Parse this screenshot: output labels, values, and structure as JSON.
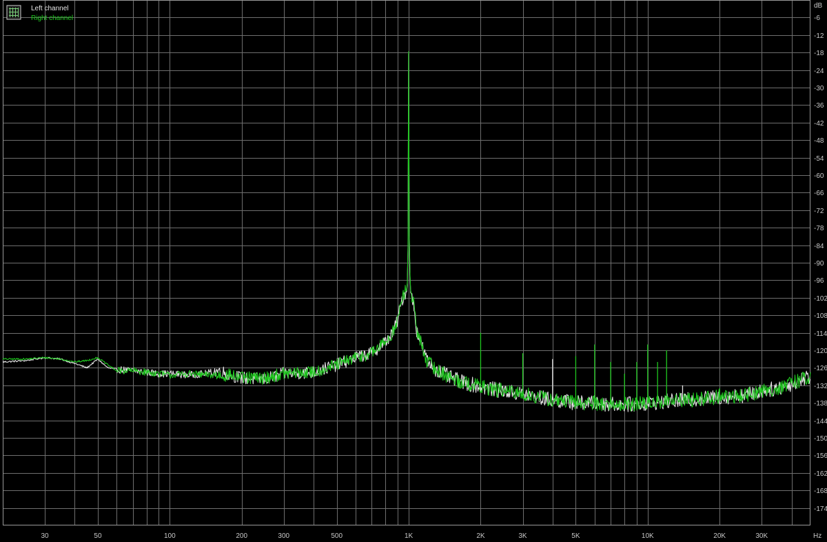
{
  "chart_data": {
    "type": "line",
    "title": "",
    "xlabel": "",
    "ylabel": "",
    "x_scale": "log",
    "x_unit": "Hz",
    "y_unit": "dB",
    "xlim": [
      20,
      48000
    ],
    "ylim": [
      -180,
      0
    ],
    "grid": true,
    "legend": "top-left",
    "x_tick_labels": [
      {
        "value": 30,
        "label": "30"
      },
      {
        "value": 50,
        "label": "50"
      },
      {
        "value": 100,
        "label": "100"
      },
      {
        "value": 200,
        "label": "200"
      },
      {
        "value": 300,
        "label": "300"
      },
      {
        "value": 500,
        "label": "500"
      },
      {
        "value": 1000,
        "label": "1K"
      },
      {
        "value": 2000,
        "label": "2K"
      },
      {
        "value": 3000,
        "label": "3K"
      },
      {
        "value": 5000,
        "label": "5K"
      },
      {
        "value": 10000,
        "label": "10K"
      },
      {
        "value": 20000,
        "label": "20K"
      },
      {
        "value": 30000,
        "label": "30K"
      }
    ],
    "y_ticks": [
      -6,
      -12,
      -18,
      -24,
      -30,
      -36,
      -42,
      -48,
      -54,
      -60,
      -66,
      -72,
      -78,
      -84,
      -90,
      -96,
      -102,
      -108,
      -114,
      -120,
      -126,
      -132,
      -138,
      -144,
      -150,
      -156,
      -162,
      -168,
      -174
    ],
    "colors": {
      "background": "#000000",
      "grid": "#6f6f6f",
      "left": "#e6e6e6",
      "right": "#1fc81f",
      "tick": "#c8c8c8"
    },
    "series": [
      {
        "name": "Left channel",
        "x": [
          20,
          25,
          30,
          35,
          40,
          45,
          50,
          55,
          60,
          70,
          80,
          90,
          100,
          120,
          140,
          160,
          180,
          200,
          250,
          300,
          400,
          500,
          600,
          700,
          800,
          850,
          900,
          930,
          950,
          970,
          985,
          995,
          1000,
          1005,
          1015,
          1030,
          1050,
          1080,
          1100,
          1150,
          1200,
          1300,
          1400,
          1500,
          1700,
          2000,
          2500,
          3000,
          4000,
          5000,
          6000,
          7000,
          8000,
          9000,
          10000,
          12000,
          15000,
          20000,
          25000,
          30000,
          35000,
          40000,
          45000,
          48000
        ],
        "y": [
          -124,
          -123.5,
          -122.5,
          -123,
          -124.5,
          -126,
          -123,
          -126,
          -126.5,
          -127,
          -127.5,
          -128,
          -128,
          -128.5,
          -128,
          -127,
          -128.5,
          -129.5,
          -130,
          -128,
          -127.5,
          -125,
          -122.5,
          -121,
          -117,
          -114.5,
          -109.5,
          -104,
          -101,
          -100,
          -100,
          -80,
          -4,
          -80,
          -100,
          -101,
          -105,
          -113,
          -115,
          -120,
          -124,
          -126.5,
          -128,
          -129.5,
          -131,
          -132.5,
          -134,
          -135,
          -137,
          -138,
          -138,
          -138.5,
          -138.5,
          -138.5,
          -138,
          -137.5,
          -137,
          -136,
          -135.5,
          -134,
          -133,
          -131.5,
          -129.5,
          -129
        ]
      },
      {
        "name": "Right channel",
        "x": [
          20,
          25,
          30,
          35,
          40,
          45,
          50,
          55,
          60,
          70,
          80,
          90,
          100,
          120,
          140,
          160,
          180,
          200,
          250,
          300,
          400,
          500,
          600,
          700,
          800,
          850,
          900,
          930,
          950,
          970,
          985,
          995,
          1000,
          1005,
          1015,
          1030,
          1050,
          1080,
          1100,
          1150,
          1200,
          1300,
          1400,
          1500,
          1700,
          2000,
          2500,
          3000,
          4000,
          5000,
          6000,
          7000,
          8000,
          9000,
          10000,
          12000,
          15000,
          20000,
          25000,
          30000,
          35000,
          40000,
          45000,
          48000
        ],
        "y": [
          -123,
          -123,
          -122.5,
          -123,
          -124,
          -123.5,
          -122.5,
          -125,
          -127,
          -127,
          -127.5,
          -128,
          -128.5,
          -128,
          -128.5,
          -128.5,
          -128.5,
          -129.5,
          -129.5,
          -128,
          -127.5,
          -125,
          -122.5,
          -121,
          -117,
          -114.5,
          -109.5,
          -104,
          -101,
          -100,
          -99,
          -80,
          -3,
          -80,
          -99,
          -101,
          -105,
          -113,
          -115,
          -120,
          -124,
          -126.5,
          -128,
          -129.5,
          -131,
          -132.5,
          -134,
          -135,
          -137,
          -138,
          -138,
          -138.5,
          -138.5,
          -138.5,
          -138,
          -137.5,
          -137,
          -136,
          -135.5,
          -134,
          -133,
          -131.5,
          -129.5,
          -129
        ]
      }
    ],
    "spurs": [
      {
        "x": 2000,
        "y": -114,
        "series": "Right channel"
      },
      {
        "x": 3000,
        "y": -121,
        "series": "Right channel"
      },
      {
        "x": 4000,
        "y": -123,
        "series": "Left channel"
      },
      {
        "x": 5000,
        "y": -122,
        "series": "Right channel"
      },
      {
        "x": 6000,
        "y": -118,
        "series": "Right channel"
      },
      {
        "x": 7000,
        "y": -124,
        "series": "Right channel"
      },
      {
        "x": 8000,
        "y": -128,
        "series": "Right channel"
      },
      {
        "x": 9000,
        "y": -124,
        "series": "Right channel"
      },
      {
        "x": 10000,
        "y": -118,
        "series": "Right channel"
      },
      {
        "x": 11000,
        "y": -124,
        "series": "Right channel"
      },
      {
        "x": 12000,
        "y": -120,
        "series": "Right channel"
      },
      {
        "x": 14000,
        "y": -132,
        "series": "Left channel"
      },
      {
        "x": 20000,
        "y": -133,
        "series": "Right channel"
      }
    ]
  }
}
